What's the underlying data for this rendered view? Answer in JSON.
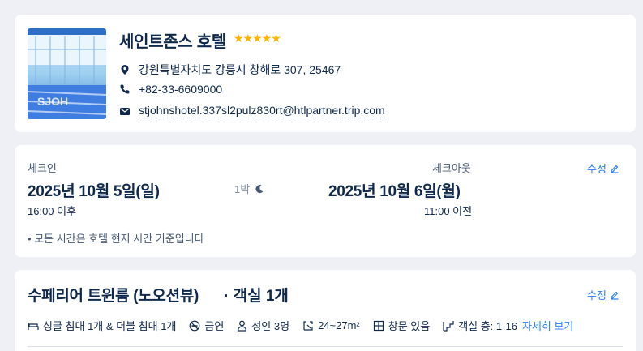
{
  "hotel": {
    "name": "세인트존스 호텔",
    "stars": "★★★★★",
    "address": "강원특별자치도 강릉시 창해로 307, 25467",
    "phone": "+82-33-6609000",
    "email": "stjohnshotel.337sl2pulz830rt@htlpartner.trip.com"
  },
  "stay": {
    "checkin_label": "체크인",
    "checkout_label": "체크아웃",
    "checkin_date": "2025년 10월 5일(일)",
    "checkout_date": "2025년 10월 6일(월)",
    "checkin_time": "16:00 이후",
    "checkout_time": "11:00 이전",
    "nights": "1박",
    "edit_label": "수정",
    "note": "• 모든 시간은 호텔 현지 시간 기준입니다"
  },
  "room": {
    "name": "수페리어 트윈룸 (노오션뷰)",
    "count": "· 객실 1개",
    "edit_label": "수정",
    "amenities": {
      "beds": "싱글 침대 1개 & 더블 침대 1개",
      "smoking": "금연",
      "guests": "성인 3명",
      "size": "24~27m²",
      "window": "창문 있음",
      "floor": "객실 층: 1-16"
    },
    "more_label": "자세히 보기"
  },
  "colors": {
    "accent": "#287dfa",
    "star": "#ffb400",
    "text": "#0f294d",
    "background": "#eef0f5"
  }
}
